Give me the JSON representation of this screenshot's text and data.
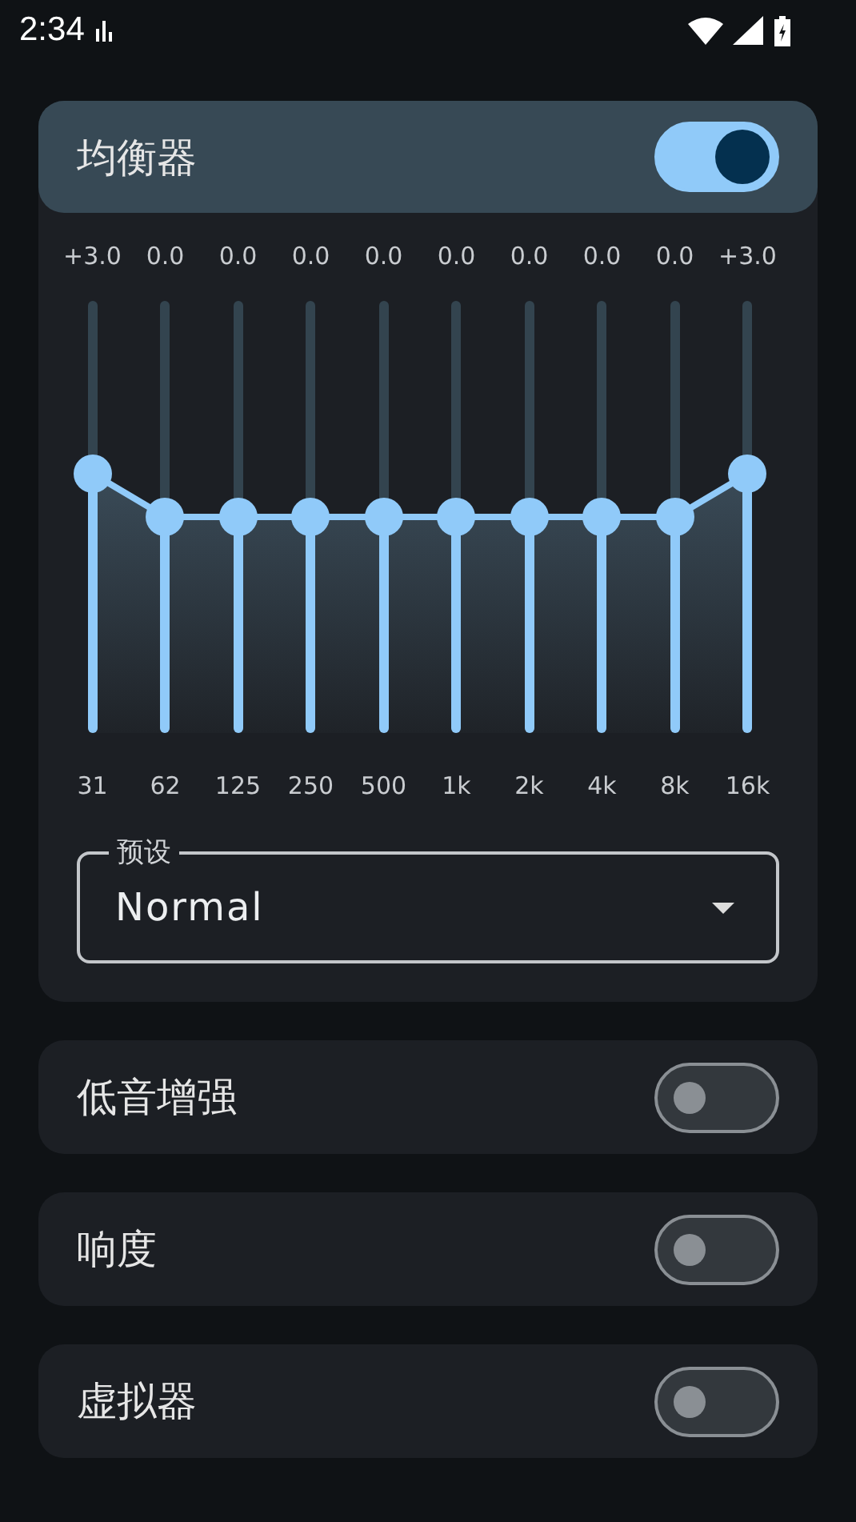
{
  "status_bar": {
    "time": "2:34"
  },
  "equalizer": {
    "title": "均衡器",
    "on": true,
    "bands": [
      {
        "value": "+3.0",
        "freq": "31",
        "level": 0.6
      },
      {
        "value": "0.0",
        "freq": "62",
        "level": 0.5
      },
      {
        "value": "0.0",
        "freq": "125",
        "level": 0.5
      },
      {
        "value": "0.0",
        "freq": "250",
        "level": 0.5
      },
      {
        "value": "0.0",
        "freq": "500",
        "level": 0.5
      },
      {
        "value": "0.0",
        "freq": "1k",
        "level": 0.5
      },
      {
        "value": "0.0",
        "freq": "2k",
        "level": 0.5
      },
      {
        "value": "0.0",
        "freq": "4k",
        "level": 0.5
      },
      {
        "value": "0.0",
        "freq": "8k",
        "level": 0.5
      },
      {
        "value": "+3.0",
        "freq": "16k",
        "level": 0.6
      }
    ],
    "preset": {
      "label": "预设",
      "value": "Normal"
    }
  },
  "settings": [
    {
      "label": "低音增强",
      "on": false
    },
    {
      "label": "响度",
      "on": false
    },
    {
      "label": "虚拟器",
      "on": false
    }
  ]
}
